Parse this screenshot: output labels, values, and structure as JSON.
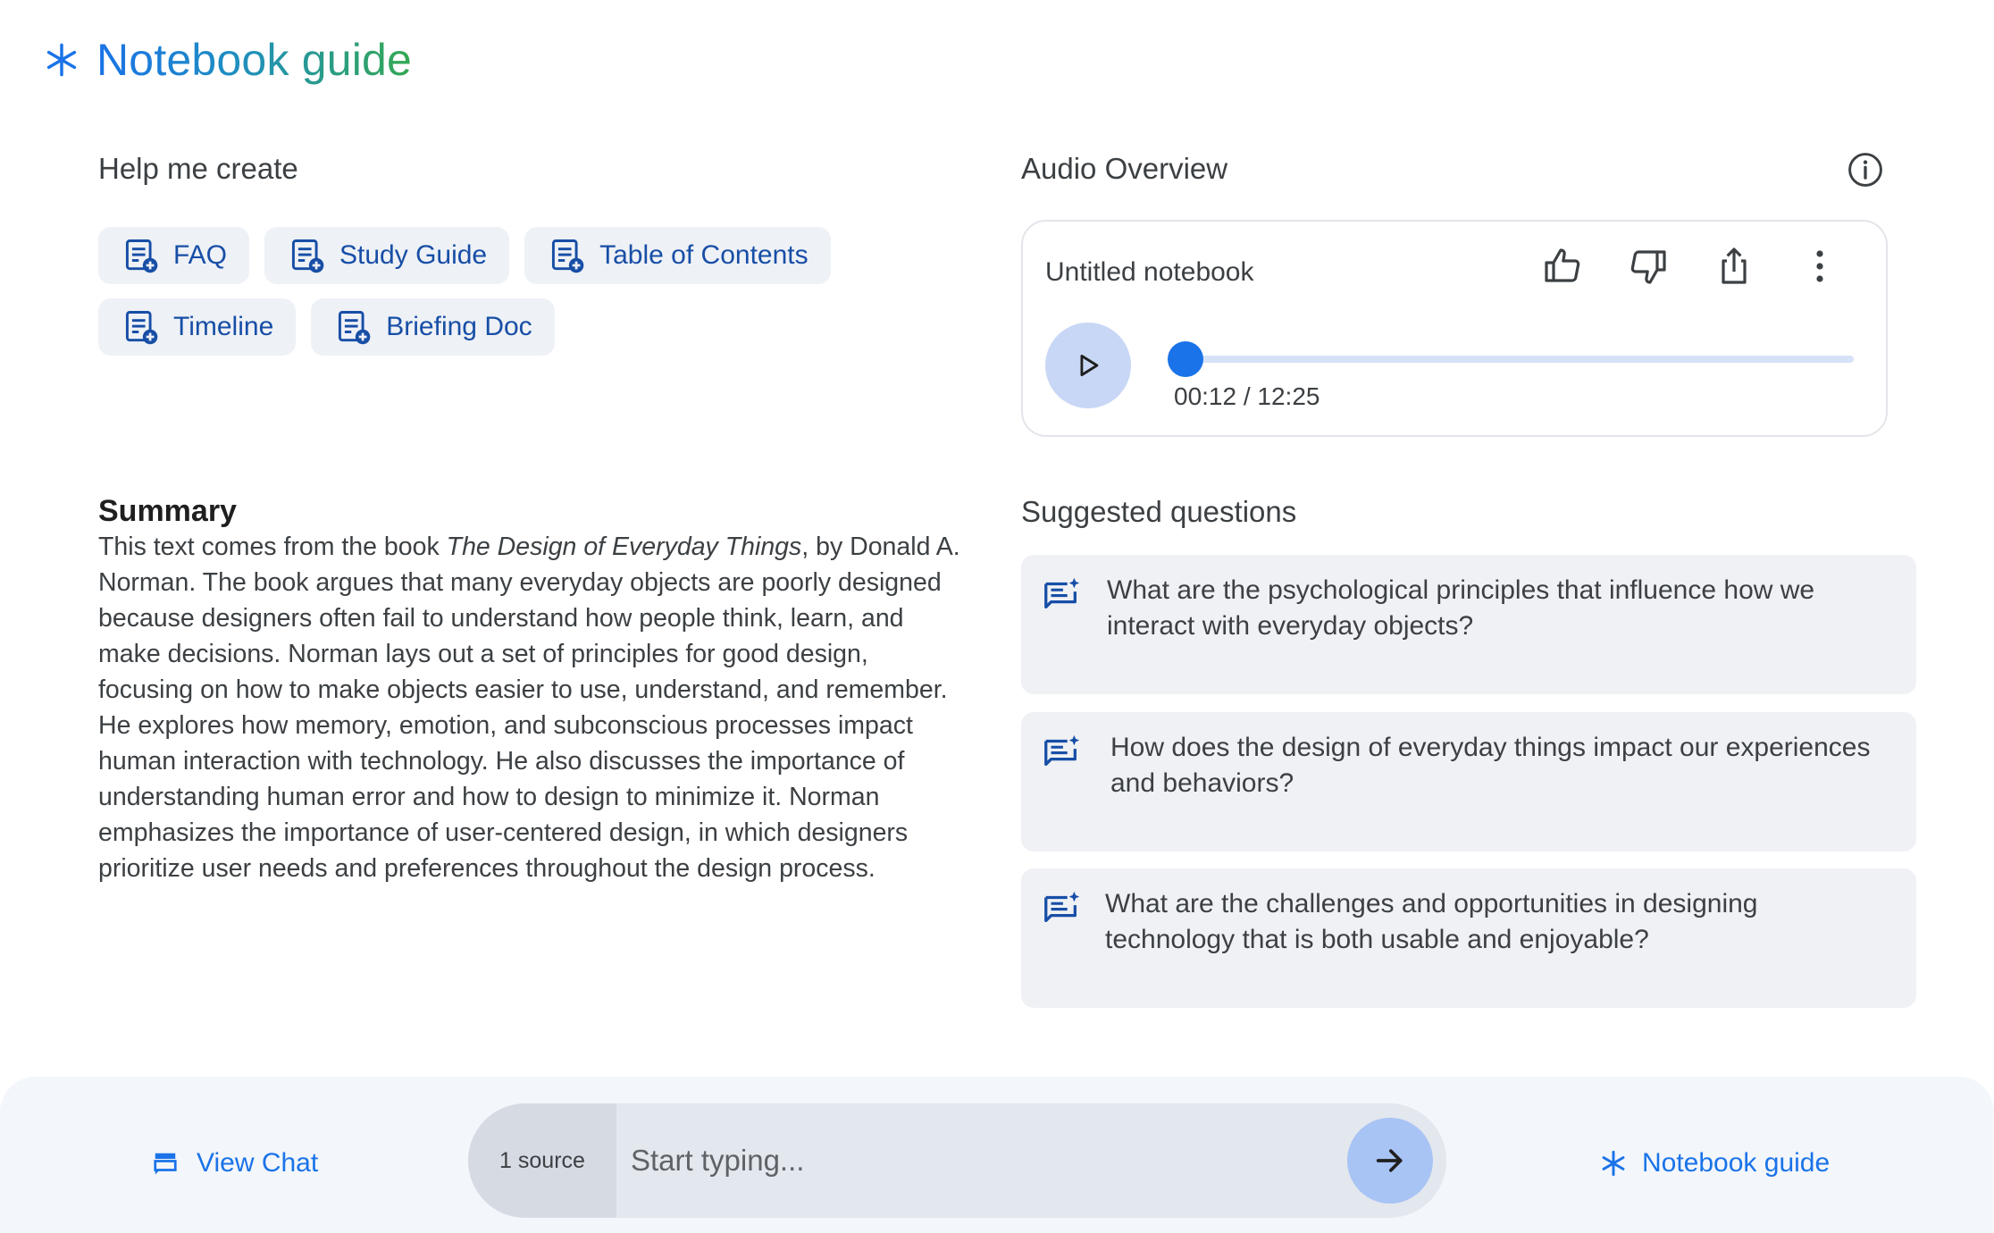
{
  "header": {
    "title": "Notebook guide",
    "icon": "sparkle-icon"
  },
  "help_create": {
    "title": "Help me create",
    "chips": [
      {
        "label": "FAQ",
        "icon": "note-add-icon"
      },
      {
        "label": "Study Guide",
        "icon": "note-add-icon"
      },
      {
        "label": "Table of Contents",
        "icon": "note-add-icon"
      },
      {
        "label": "Timeline",
        "icon": "note-add-icon"
      },
      {
        "label": "Briefing Doc",
        "icon": "note-add-icon"
      }
    ]
  },
  "summary": {
    "title": "Summary",
    "text_before": "This text comes from the book ",
    "book_title": "The Design of Everyday Things",
    "text_after": ", by Donald A. Norman. The book argues that many everyday objects are poorly designed because designers often fail to understand how people think, learn, and make decisions. Norman lays out a set of principles for good design, focusing on how to make objects easier to use, understand, and remember. He explores how memory, emotion, and subconscious processes impact human interaction with technology. He also discusses the importance of understanding human error and how to design to minimize it. Norman emphasizes the importance of user-centered design, in which designers prioritize user needs and preferences throughout the design process."
  },
  "audio_overview": {
    "title": "Audio Overview",
    "notebook_name": "Untitled notebook",
    "time_display": "00:12 / 12:25",
    "progress_fraction": 0.016,
    "actions": [
      "thumbs-up-icon",
      "thumbs-down-icon",
      "share-icon",
      "more-vert-icon"
    ]
  },
  "suggested_questions": {
    "title": "Suggested questions",
    "items": [
      "What are the psychological principles that influence how we interact with everyday objects?",
      "How does the design of everyday things impact our experiences and behaviors?",
      "What are the challenges and opportunities in designing technology that is both usable and enjoyable?"
    ]
  },
  "footer": {
    "view_chat_label": "View Chat",
    "source_label": "1 source",
    "input_placeholder": "Start typing...",
    "input_value": "",
    "notebook_guide_label": "Notebook guide"
  },
  "colors": {
    "accent": "#1a73e8",
    "chip_text": "#174ea6",
    "chip_bg": "#eef1f6",
    "play_bg": "#c9d7f6",
    "send_bg": "#a8c4f5"
  }
}
